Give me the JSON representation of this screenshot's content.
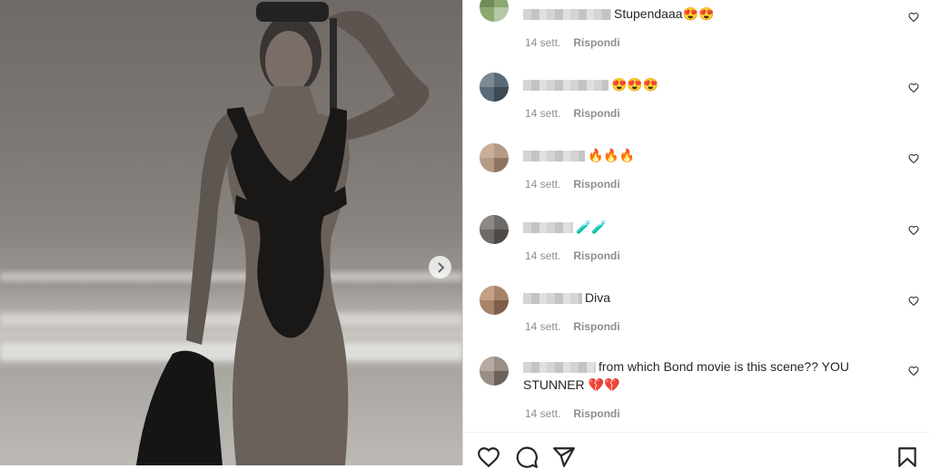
{
  "post": {
    "next_icon": "chevron-right-icon"
  },
  "comments": [
    {
      "text": "Stupendaaa",
      "emoji": "😍😍",
      "time": "14 sett.",
      "reply": "Rispondi"
    },
    {
      "text": "",
      "emoji": "😍😍😍",
      "time": "14 sett.",
      "reply": "Rispondi"
    },
    {
      "text": "",
      "emoji": "🔥🔥🔥",
      "time": "14 sett.",
      "reply": "Rispondi"
    },
    {
      "text": "",
      "emoji": "🧪🧪",
      "time": "14 sett.",
      "reply": "Rispondi"
    },
    {
      "text": "Diva",
      "emoji": "",
      "time": "14 sett.",
      "reply": "Rispondi"
    },
    {
      "text": "from which Bond movie is this scene?? YOU STUNNER",
      "emoji": "💔💔",
      "time": "14 sett.",
      "reply": "Rispondi"
    }
  ],
  "actions": {
    "like_icon": "heart-icon",
    "comment_icon": "comment-icon",
    "share_icon": "send-icon",
    "save_icon": "bookmark-icon"
  }
}
